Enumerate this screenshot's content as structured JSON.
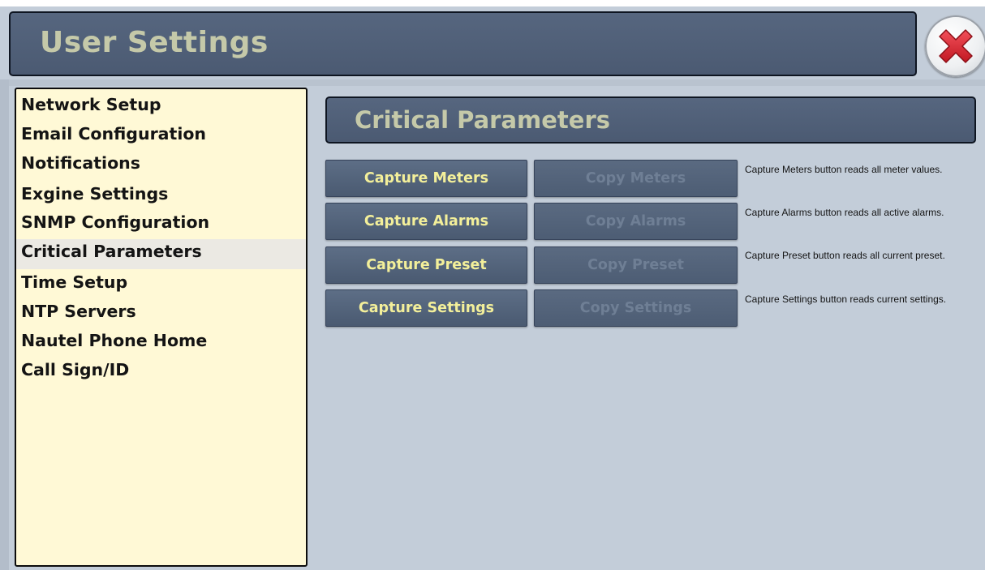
{
  "header": {
    "title": "User Settings",
    "close_icon": "close-x-icon",
    "close_icon_color": "#d9232e"
  },
  "sidebar": {
    "items": [
      {
        "label": "Network Setup",
        "selected": false
      },
      {
        "label": "Email Configuration",
        "selected": false
      },
      {
        "label": "Notifications",
        "selected": false
      },
      {
        "label": "Exgine Settings",
        "selected": false
      },
      {
        "label": "SNMP Configuration",
        "selected": false
      },
      {
        "label": "Critical Parameters",
        "selected": true
      },
      {
        "label": "Time Setup",
        "selected": false
      },
      {
        "label": "NTP Servers",
        "selected": false
      },
      {
        "label": "Nautel Phone Home",
        "selected": false
      },
      {
        "label": "Call Sign/ID",
        "selected": false
      }
    ]
  },
  "main": {
    "title": "Critical Parameters",
    "rows": [
      {
        "capture_label": "Capture Meters",
        "copy_label": "Copy Meters",
        "copy_enabled": false,
        "description": "Capture Meters button reads all meter values."
      },
      {
        "capture_label": "Capture Alarms",
        "copy_label": "Copy Alarms",
        "copy_enabled": false,
        "description": "Capture Alarms button reads all active alarms."
      },
      {
        "capture_label": "Capture Preset",
        "copy_label": "Copy Preset",
        "copy_enabled": false,
        "description": "Capture Preset button reads all current preset."
      },
      {
        "capture_label": "Capture Settings",
        "copy_label": "Copy Settings",
        "copy_enabled": false,
        "description": "Capture Settings button reads current settings."
      }
    ]
  },
  "colors": {
    "background": "#c3cdd9",
    "header_bg": "#52627a",
    "header_text": "#c5c9a9",
    "sidebar_bg": "#fff9d6",
    "sidebar_selected": "#ebe9e3",
    "capture_text": "#f3ef9a",
    "copy_text_disabled": "#6f7f95"
  }
}
